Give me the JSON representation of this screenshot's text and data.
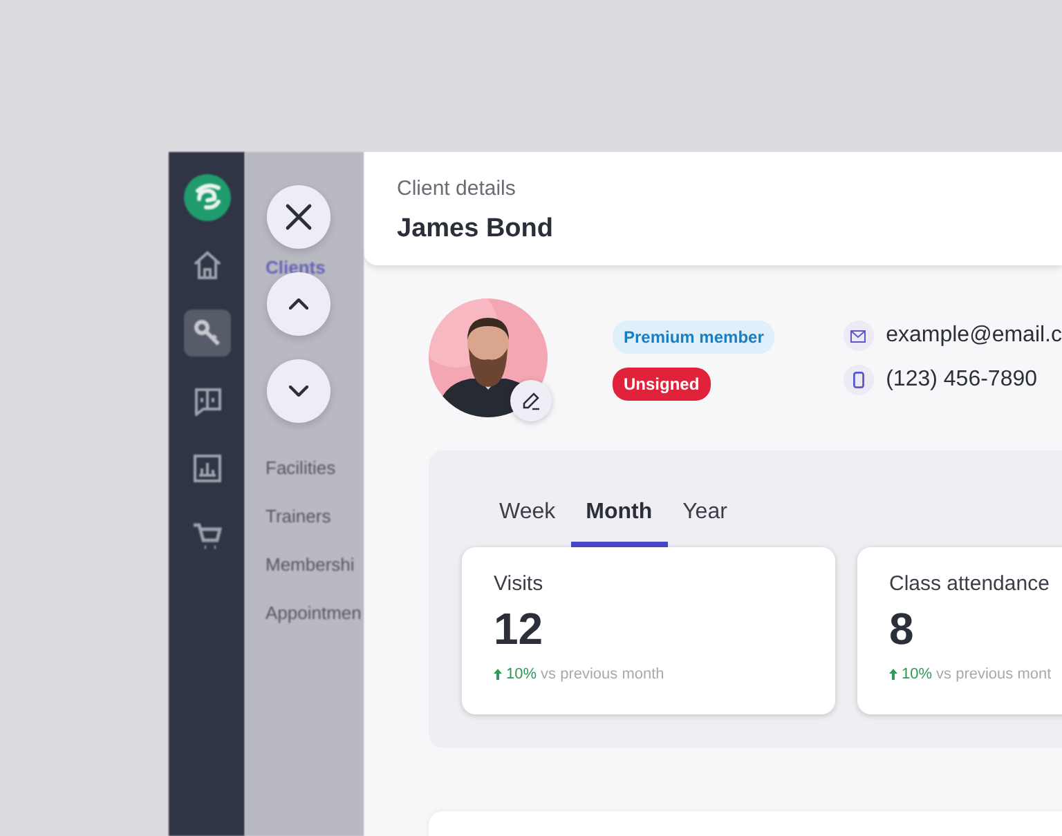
{
  "nav_rail": {
    "items": [
      {
        "kind": "logo",
        "selected": false
      },
      {
        "kind": "home",
        "selected": false
      },
      {
        "kind": "key",
        "selected": true
      },
      {
        "kind": "book",
        "selected": false
      },
      {
        "kind": "chart",
        "selected": false
      },
      {
        "kind": "cart",
        "selected": false
      }
    ]
  },
  "sidebar": {
    "items": [
      {
        "label": "Clients",
        "selected": true
      },
      {
        "label": "Facilities",
        "selected": false
      },
      {
        "label": "Trainers",
        "selected": false
      },
      {
        "label": "Membershi",
        "selected": false
      },
      {
        "label": "Appointmen",
        "selected": false
      }
    ]
  },
  "header": {
    "title": "Client details",
    "name": "James Bond"
  },
  "profile": {
    "badges": [
      {
        "label": "Premium member",
        "color": "#dff0fa"
      },
      {
        "label": "Unsigned",
        "color": "#e0233a"
      }
    ],
    "contacts": [
      {
        "kind": "email",
        "text": "example@email.c"
      },
      {
        "kind": "phone",
        "text": "(123) 456-7890"
      }
    ]
  },
  "stats": {
    "tabs": [
      {
        "label": "Week",
        "selected": false
      },
      {
        "label": "Month",
        "selected": true
      },
      {
        "label": "Year",
        "selected": false
      }
    ],
    "cards": [
      {
        "label": "Visits",
        "value": "12",
        "change": "10%",
        "comparison": "vs previous month"
      },
      {
        "label": "Class attendance",
        "value": "8",
        "change": "10%",
        "comparison": "vs previous mont"
      }
    ]
  }
}
